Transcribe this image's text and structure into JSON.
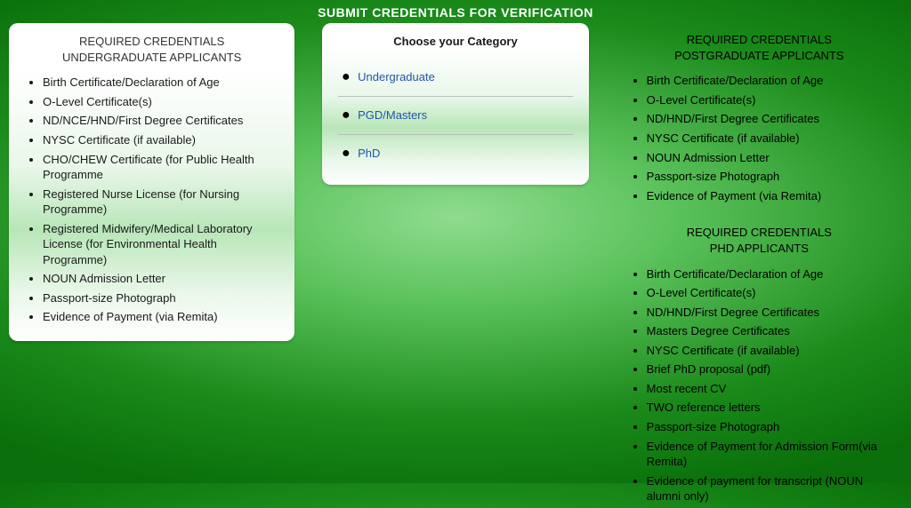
{
  "page_title": "SUBMIT CREDENTIALS FOR VERIFICATION",
  "left": {
    "heading_line1": "REQUIRED CREDENTIALS",
    "heading_line2": "UNDERGRADUATE APPLICANTS",
    "items": [
      "Birth Certificate/Declaration of Age",
      "O-Level Certificate(s)",
      "ND/NCE/HND/First Degree Certificates",
      "NYSC Certificate (if available)",
      "CHO/CHEW Certificate (for Public Health Programme",
      "Registered Nurse License (for Nursing Programme)",
      "Registered Midwifery/Medical Laboratory License (for Environmental Health Programme)",
      "NOUN Admission Letter",
      "Passport-size Photograph",
      "Evidence of Payment (via Remita)"
    ]
  },
  "center": {
    "heading": "Choose your Category",
    "options": [
      "Undergraduate",
      "PGD/Masters",
      "PhD"
    ]
  },
  "right_pg": {
    "heading_line1": "REQUIRED CREDENTIALS",
    "heading_line2": "POSTGRADUATE APPLICANTS",
    "items": [
      "Birth Certificate/Declaration of Age",
      "O-Level Certificate(s)",
      "ND/HND/First Degree Certificates",
      "NYSC Certificate (if available)",
      "NOUN Admission Letter",
      "Passport-size Photograph",
      "Evidence of Payment (via Remita)"
    ]
  },
  "right_phd": {
    "heading_line1": "REQUIRED CREDENTIALS",
    "heading_line2": "PHD APPLICANTS",
    "items": [
      "Birth Certificate/Declaration of Age",
      "O-Level Certificate(s)",
      "ND/HND/First Degree Certificates",
      "Masters Degree Certificates",
      "NYSC Certificate (if available)",
      "Brief PhD proposal (pdf)",
      "Most recent CV",
      "TWO reference letters",
      "Passport-size Photograph",
      "Evidence of Payment for Admission Form(via Remita)",
      "Evidence of payment for transcript (NOUN alumni only)"
    ]
  }
}
